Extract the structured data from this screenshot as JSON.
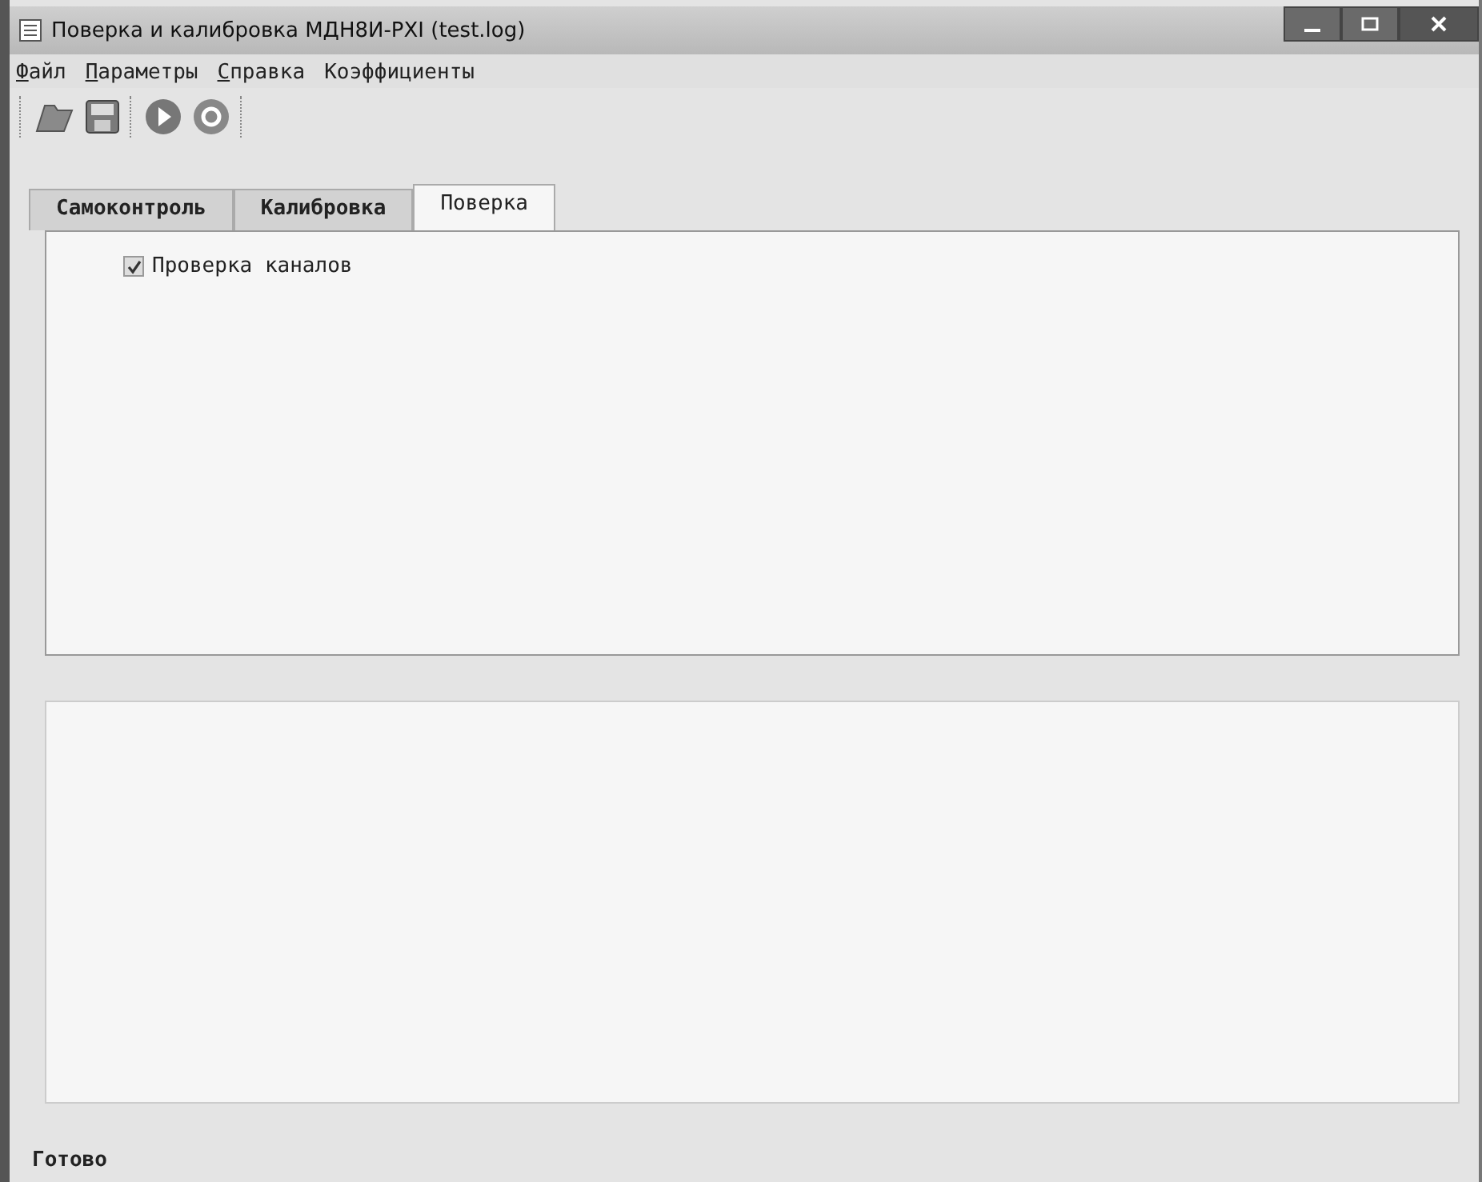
{
  "window": {
    "title": "Поверка и калибровка МДН8И-PXI (test.log)"
  },
  "menu": [
    {
      "label": "Файл",
      "mnemonic": true
    },
    {
      "label": "Параметры",
      "mnemonic": true
    },
    {
      "label": "Справка",
      "mnemonic": true
    },
    {
      "label": "Коэффициенты",
      "mnemonic": false
    }
  ],
  "tabs": [
    {
      "label": "Самоконтроль",
      "selected": false
    },
    {
      "label": "Калибровка",
      "selected": false
    },
    {
      "label": "Поверка",
      "selected": true
    }
  ],
  "options": [
    {
      "label": "Проверка каналов",
      "checked": true
    }
  ],
  "status_bar": "Готово"
}
